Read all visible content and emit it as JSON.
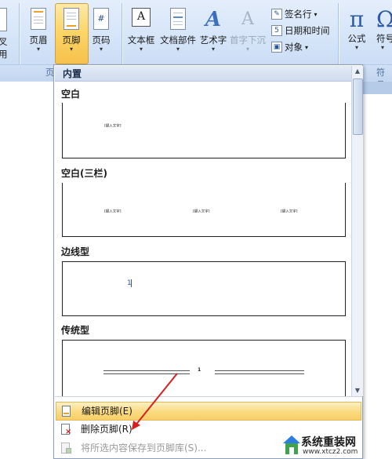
{
  "ribbon": {
    "partial_left_label_1": "叉",
    "partial_left_label_2": "用",
    "header_label": "页眉",
    "footer_label": "页脚",
    "page_number_label": "页码",
    "textbox_label": "文本框",
    "quickparts_label": "文档部件",
    "wordart_label": "艺术字",
    "dropcap_label": "首字下沉",
    "signature_label": "签名行",
    "datetime_label": "日期和时间",
    "object_label": "对象",
    "equation_label": "公式",
    "symbol_label": "符号",
    "group_header_footer_partial": "页",
    "group_symbol_partial": "符号",
    "equation_glyph": "π",
    "symbol_glyph": "Ω",
    "page_number_glyph": "#",
    "textbox_glyph": "A",
    "wordart_glyph": "A",
    "dropcap_glyph": "A"
  },
  "gallery": {
    "header": "内置",
    "sections": [
      {
        "title": "空白",
        "placeholders": [
          "[键入文字]"
        ]
      },
      {
        "title": "空白(三栏)",
        "placeholders": [
          "[键入文字]",
          "[键入文字]",
          "[键入文字]"
        ]
      },
      {
        "title": "边线型",
        "placeholders": [
          "1"
        ]
      },
      {
        "title": "传统型",
        "placeholders": [
          "1"
        ]
      }
    ]
  },
  "menu": {
    "edit_footer": "编辑页脚(E)",
    "remove_footer": "删除页脚(R)",
    "save_selection": "将所选内容保存到页脚库(S)..."
  },
  "watermark": {
    "site_name": "系统重装网",
    "url": "www.xtcz2.com"
  },
  "colors": {
    "ribbon_bg": "#d3e3f8",
    "active_button": "#fcd669",
    "highlight_menu": "#fbdc84",
    "arrow": "#d42020"
  }
}
